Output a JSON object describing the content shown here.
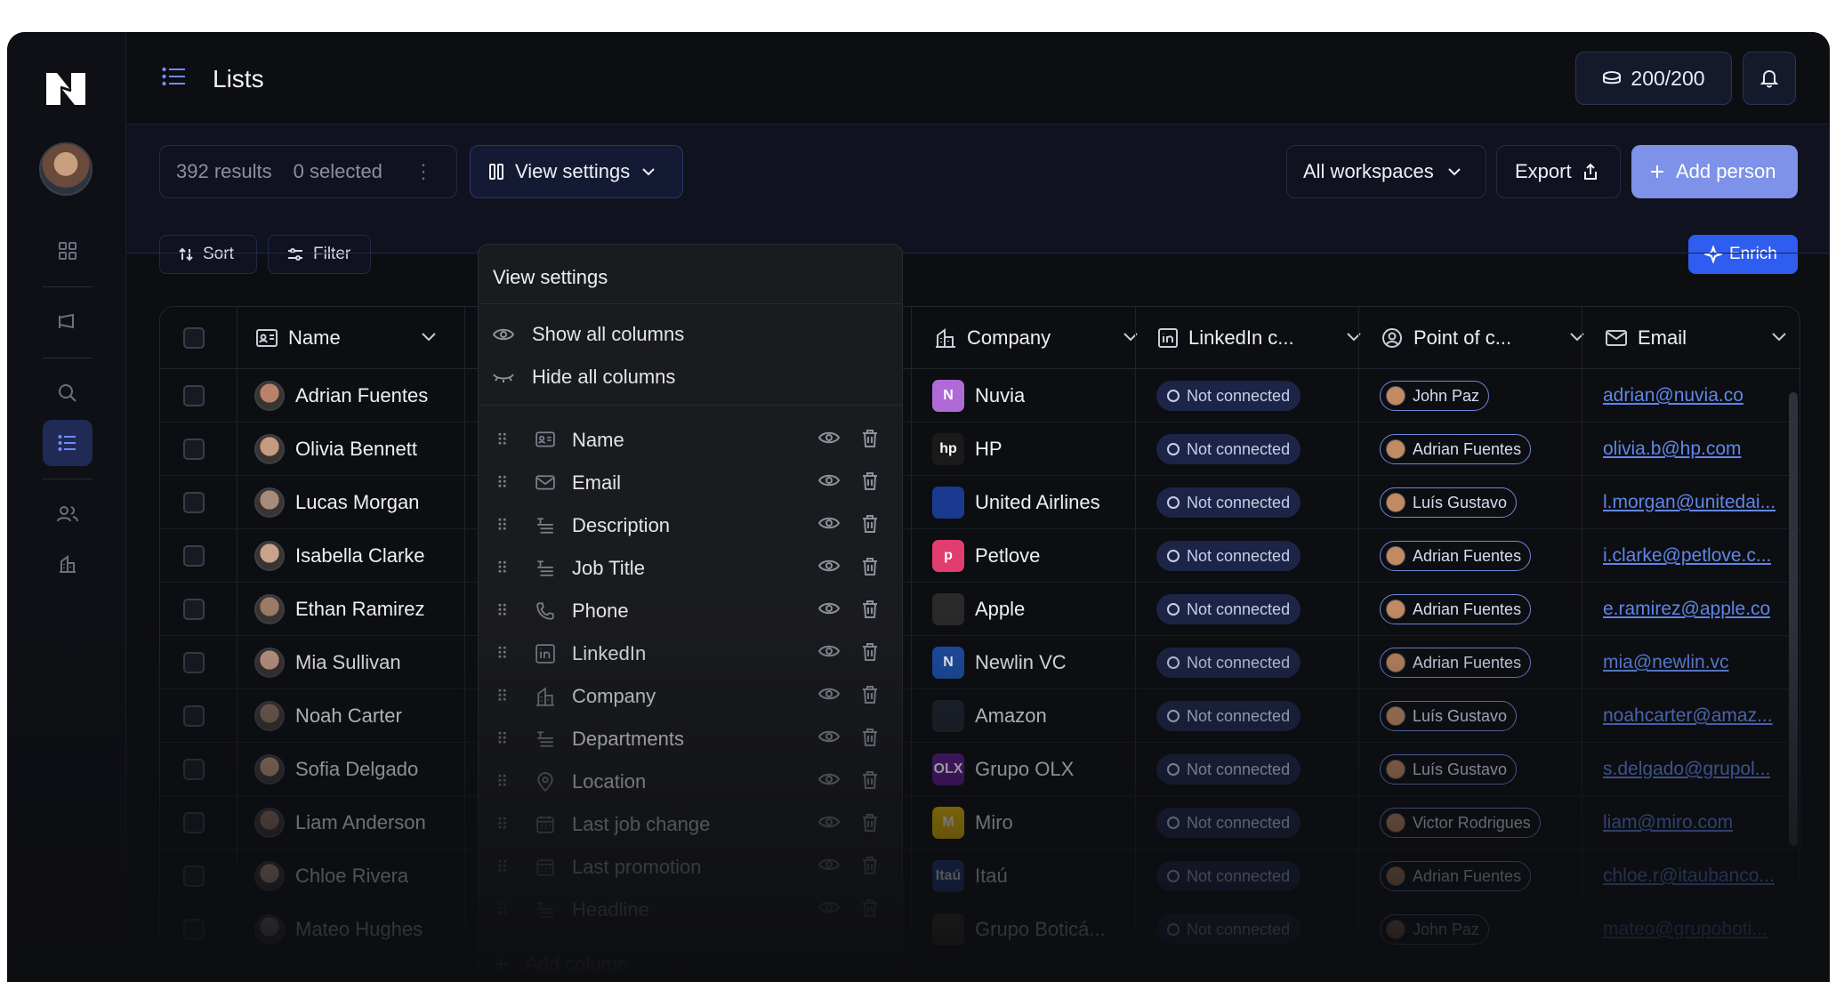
{
  "app": {
    "brand_icon": "hubspot-like-logo"
  },
  "header": {
    "title": "Lists",
    "credits": "200/200"
  },
  "toolbar": {
    "results": "392 results",
    "selected": "0 selected",
    "view_settings": "View settings",
    "workspace": "All workspaces",
    "export": "Export",
    "add_person": "Add person",
    "sort": "Sort",
    "filter": "Filter",
    "enrich": "Enrich"
  },
  "table": {
    "columns": [
      "Name",
      "Company",
      "LinkedIn c...",
      "Point of c...",
      "Email"
    ],
    "rows": [
      {
        "name": "Adrian Fuentes",
        "company": "Nuvia",
        "linkedin": "Not connected",
        "poc": "John Paz",
        "email": "adrian@nuvia.co"
      },
      {
        "name": "Olivia Bennett",
        "company": "HP",
        "linkedin": "Not connected",
        "poc": "Adrian Fuentes",
        "email": "olivia.b@hp.com"
      },
      {
        "name": "Lucas Morgan",
        "company": "United Airlines",
        "linkedin": "Not connected",
        "poc": "Luís Gustavo",
        "email": "l.morgan@unitedai..."
      },
      {
        "name": "Isabella Clarke",
        "company": "Petlove",
        "linkedin": "Not connected",
        "poc": "Adrian Fuentes",
        "email": "i.clarke@petlove.c..."
      },
      {
        "name": "Ethan Ramirez",
        "company": "Apple",
        "linkedin": "Not connected",
        "poc": "Adrian Fuentes",
        "email": "e.ramirez@apple.co"
      },
      {
        "name": "Mia Sullivan",
        "company": "Newlin VC",
        "linkedin": "Not connected",
        "poc": "Adrian Fuentes",
        "email": "mia@newlin.vc"
      },
      {
        "name": "Noah Carter",
        "company": "Amazon",
        "linkedin": "Not connected",
        "poc": "Luís Gustavo",
        "email": "noahcarter@amaz..."
      },
      {
        "name": "Sofia Delgado",
        "company": "Grupo OLX",
        "linkedin": "Not connected",
        "poc": "Luís Gustavo",
        "email": "s.delgado@grupol..."
      },
      {
        "name": "Liam Anderson",
        "company": "Miro",
        "linkedin": "Not connected",
        "poc": "Victor Rodrigues",
        "email": "liam@miro.com"
      },
      {
        "name": "Chloe Rivera",
        "company": "Itaú",
        "linkedin": "Not connected",
        "poc": "Adrian Fuentes",
        "email": "chloe.r@itaubanco..."
      },
      {
        "name": "Mateo Hughes",
        "company": "Grupo Boticá...",
        "linkedin": "Not connected",
        "poc": "John Paz",
        "email": "mateo@grupoboti..."
      }
    ]
  },
  "dropdown": {
    "title": "View settings",
    "show_all": "Show all columns",
    "hide_all": "Hide all columns",
    "fields": [
      {
        "label": "Name",
        "icon": "id-card-icon"
      },
      {
        "label": "Email",
        "icon": "mail-icon"
      },
      {
        "label": "Description",
        "icon": "text-lines-icon"
      },
      {
        "label": "Job Title",
        "icon": "text-lines-icon"
      },
      {
        "label": "Phone",
        "icon": "phone-icon"
      },
      {
        "label": "LinkedIn",
        "icon": "linkedin-icon"
      },
      {
        "label": "Company",
        "icon": "building-icon"
      },
      {
        "label": "Departments",
        "icon": "text-lines-icon"
      },
      {
        "label": "Location",
        "icon": "pin-icon"
      },
      {
        "label": "Last job change",
        "icon": "calendar-icon"
      },
      {
        "label": "Last promotion",
        "icon": "calendar-icon"
      },
      {
        "label": "Headline",
        "icon": "text-lines-icon"
      }
    ],
    "add_column": "Add column"
  },
  "colors": {
    "accent": "#2f5df0",
    "add_person": "#7d92e8",
    "link": "#5f86e8",
    "background": "#0d0e12"
  }
}
